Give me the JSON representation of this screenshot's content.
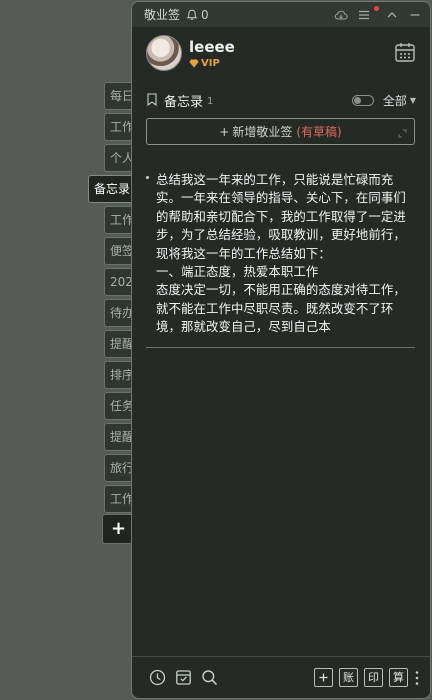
{
  "side_tabs": [
    {
      "label": "每日",
      "active": false
    },
    {
      "label": "工作",
      "active": false
    },
    {
      "label": "个人",
      "active": false
    },
    {
      "label": "备忘录",
      "active": true
    },
    {
      "label": "工作",
      "active": false
    },
    {
      "label": "便签",
      "active": false
    },
    {
      "label": "202",
      "active": false
    },
    {
      "label": "待办",
      "active": false
    },
    {
      "label": "提醒",
      "active": false
    },
    {
      "label": "排序",
      "active": false
    },
    {
      "label": "任务",
      "active": false
    },
    {
      "label": "提醒",
      "active": false
    },
    {
      "label": "旅行",
      "active": false
    },
    {
      "label": "工作",
      "active": false
    }
  ],
  "side_add_label": "+",
  "titlebar": {
    "app_title": "敬业签",
    "notification_count": "0"
  },
  "profile": {
    "username": "leeee",
    "badge": "VIP"
  },
  "memo_bar": {
    "label": "备忘录",
    "count": "1",
    "filter": "全部"
  },
  "add_note": {
    "label": "新增敬业签",
    "draft": "(有草稿)"
  },
  "note": {
    "text": "总结我这一年来的工作，只能说是忙碌而充实。一年来在领导的指导、关心下，在同事们的帮助和亲切配合下，我的工作取得了一定进步，为了总结经验，吸取教训，更好地前行，现将我这一年的工作总结如下：\n一、端正态度，热爱本职工作\n态度决定一切，不能用正确的态度对待工作，就不能在工作中尽职尽责。既然改变不了环境，那就改变自己，尽到自己本"
  },
  "bottom_buttons": {
    "ledger": "账",
    "print": "印",
    "calc": "算"
  },
  "colors": {
    "panel_bg": "#252a26",
    "vip": "#e6a23c",
    "draft": "#e06b5c",
    "desktop_bg": "#565c55"
  }
}
